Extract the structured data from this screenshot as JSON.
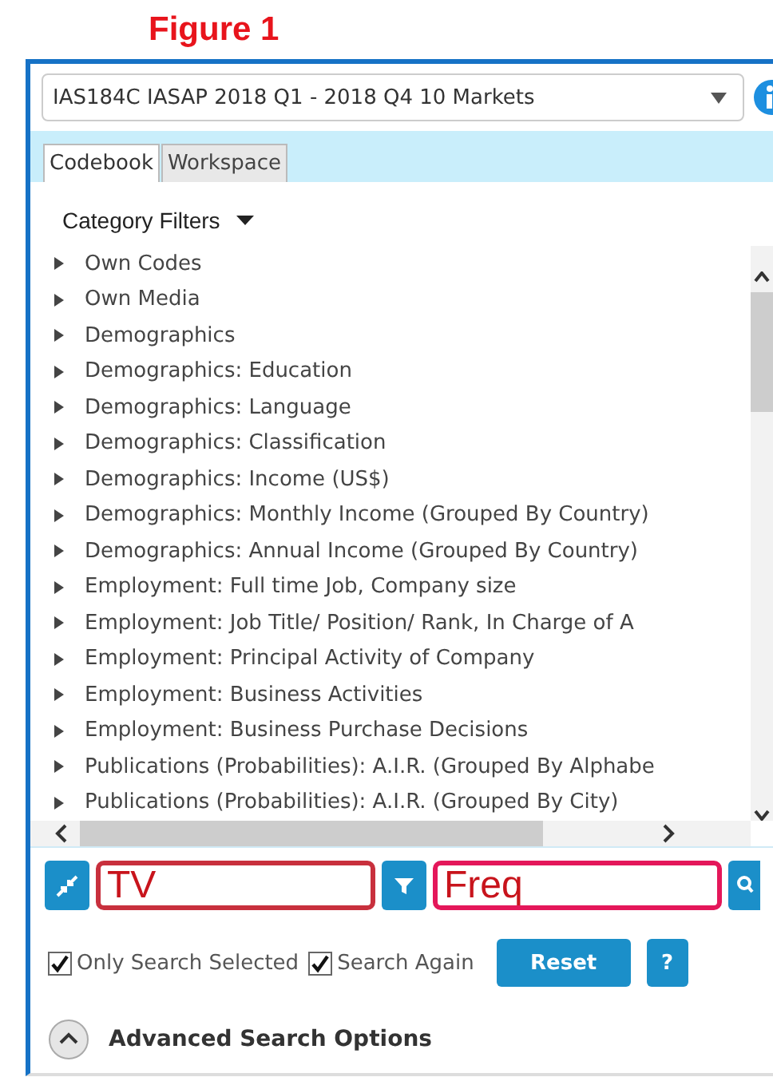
{
  "figure_title": "Figure 1",
  "dataset_select": {
    "value": "IAS184C IASAP 2018 Q1 - 2018 Q4 10 Markets"
  },
  "tabs": [
    {
      "label": "Codebook",
      "selected": true
    },
    {
      "label": "Workspace",
      "selected": false
    }
  ],
  "category_filters": {
    "label": "Category Filters"
  },
  "tree": [
    {
      "label": "Own Codes",
      "expanded": false
    },
    {
      "label": "Own Media",
      "expanded": false
    },
    {
      "label": "Demographics",
      "expanded": false
    },
    {
      "label": "Demographics: Education",
      "expanded": false
    },
    {
      "label": "Demographics: Language",
      "expanded": false
    },
    {
      "label": "Demographics: Classification",
      "expanded": false
    },
    {
      "label": "Demographics: Income (US$)",
      "expanded": false
    },
    {
      "label": "Demographics: Monthly Income (Grouped By Country)",
      "expanded": false
    },
    {
      "label": "Demographics: Annual Income (Grouped By Country)",
      "expanded": false
    },
    {
      "label": "Employment: Full time Job, Company size",
      "expanded": false
    },
    {
      "label": "Employment: Job Title/ Position/ Rank, In Charge of A",
      "expanded": false
    },
    {
      "label": "Employment: Principal Activity of Company",
      "expanded": false
    },
    {
      "label": "Employment: Business Activities",
      "expanded": false
    },
    {
      "label": "Employment: Business Purchase Decisions",
      "expanded": false
    },
    {
      "label": "Publications (Probabilities): A.I.R. (Grouped By Alphabe",
      "expanded": false
    },
    {
      "label": "Publications (Probabilities): A.I.R. (Grouped By City)",
      "expanded": false
    }
  ],
  "filter_field": {
    "value": "TV"
  },
  "search_field": {
    "value": "Freq"
  },
  "options": [
    {
      "label": "Only Search Selected",
      "checked": true
    },
    {
      "label": "Search Again",
      "checked": true
    }
  ],
  "reset_button": "Reset",
  "help_button": "?",
  "advanced": {
    "label": "Advanced Search Options",
    "expanded": false
  }
}
